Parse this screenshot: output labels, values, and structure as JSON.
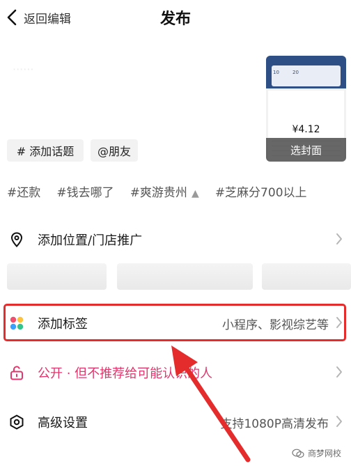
{
  "header": {
    "back_label": "返回编辑",
    "title": "发布"
  },
  "caption": {
    "text": "······"
  },
  "cover": {
    "card_a": "10",
    "card_b": "20",
    "amount": "¥4.12",
    "button_label": "选封面"
  },
  "chips": {
    "topic": "# 添加话题",
    "friend": "@朋友"
  },
  "suggested_topics": [
    "#还款",
    "#钱去哪了",
    "#爽游贵州",
    "#芝麻分700以上"
  ],
  "location": {
    "label": "添加位置/门店推广"
  },
  "tags": {
    "label": "添加标签",
    "value": "小程序、影视综艺等",
    "icon_colors": [
      "#f0506e",
      "#ffc23d",
      "#3aa0ff",
      "#33c48c"
    ]
  },
  "privacy": {
    "label": "公开 · 但不推荐给可能认识的人"
  },
  "advanced": {
    "label": "高级设置",
    "value": "支持1080P高清发布"
  },
  "watermark": {
    "text": "商梦网校"
  },
  "colors": {
    "highlight": "#e52c2c",
    "privacy": "#e0366d",
    "arrow": "#e52c2c"
  }
}
